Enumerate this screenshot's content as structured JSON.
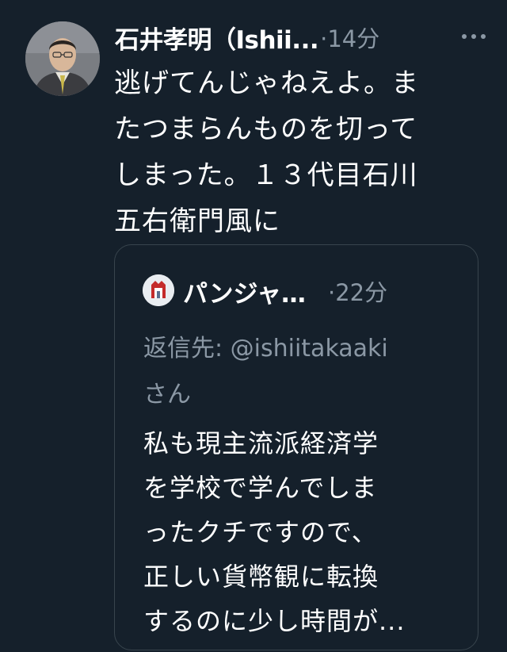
{
  "tweet": {
    "author_name": "石井孝明（Ishii...",
    "time": "·14分",
    "more_label": "···",
    "text": "逃げてんじゃねえよ。ま\nたつまらんものを切って\nしまった。１３代目石川\n五右衛門風に"
  },
  "quoted_tweet": {
    "author_name": "パンジャ…",
    "time": "·22分",
    "reply_prefix": "返信先: @ishiitakaaki",
    "reply_suffix": "さん",
    "text": "私も現主流派経済学\nを学校で学んでしま\nったクチですので、\n正しい貨幣観に転換\nするのに少し時間が..."
  },
  "colors": {
    "background": "#15202b",
    "text_primary": "#ffffff",
    "text_secondary": "#8b98a5",
    "border": "#38444d"
  }
}
